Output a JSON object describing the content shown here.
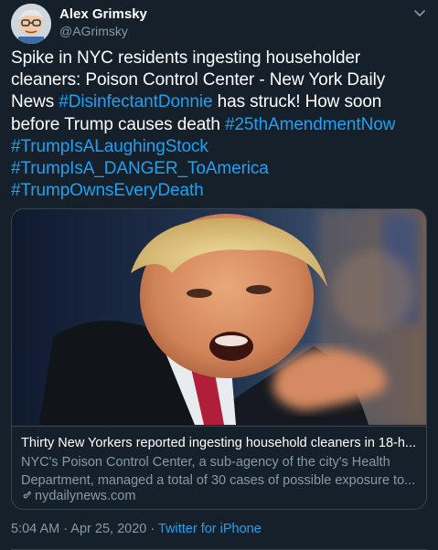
{
  "user": {
    "name": "Alex Grimsky",
    "handle": "@AGrimsky"
  },
  "tweet": {
    "segments": [
      {
        "text": "Spike in NYC residents ingesting householder cleaners: Poison Control Center - New York Daily News ",
        "hashtag": false
      },
      {
        "text": "#DisinfectantDonnie",
        "hashtag": true
      },
      {
        "text": " has struck! How soon before Trump causes death ",
        "hashtag": false
      },
      {
        "text": "#25thAmendmentNow",
        "hashtag": true
      },
      {
        "text": " ",
        "hashtag": false
      },
      {
        "text": "#TrumpIsALaughingStock",
        "hashtag": true
      },
      {
        "text": " ",
        "hashtag": false
      },
      {
        "text": "#TrumpIsA_DANGER_ToAmerica",
        "hashtag": true
      },
      {
        "text": " ",
        "hashtag": false
      },
      {
        "text": "#TrumpOwnsEveryDeath",
        "hashtag": true
      }
    ]
  },
  "card": {
    "title": "Thirty New Yorkers reported ingesting household cleaners in 18-h...",
    "description": "NYC's Poison Control Center, a sub-agency of the city's Health Department, managed a total of 30 cases of possible exposure to...",
    "domain": "nydailynews.com"
  },
  "meta": {
    "time": "5:04 AM",
    "separator": " · ",
    "date": "Apr 25, 2020",
    "source": "Twitter for iPhone"
  },
  "colors": {
    "background": "#15202b",
    "link": "#1da1f2",
    "secondary_text": "#8899a6",
    "border": "#38444d"
  }
}
